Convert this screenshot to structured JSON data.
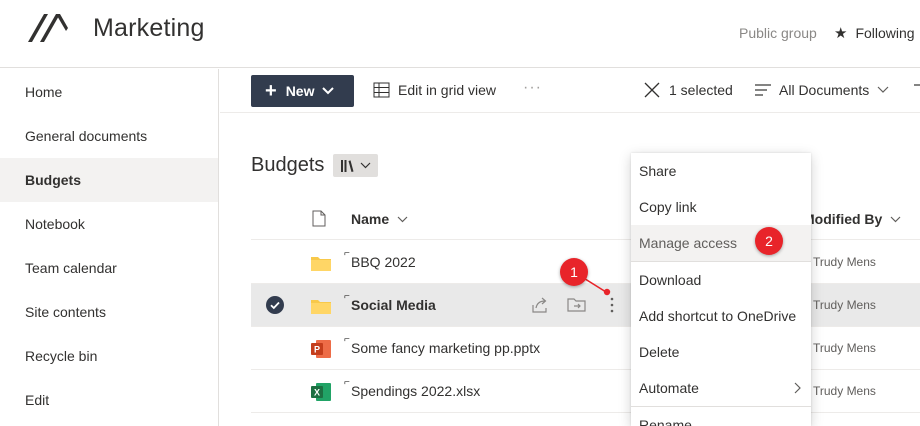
{
  "header": {
    "site_title": "Marketing",
    "public_group": "Public group",
    "following": "Following",
    "logo_icon": "marketing-logo",
    "star_icon": "star-icon"
  },
  "nav": {
    "items": [
      {
        "label": "Home"
      },
      {
        "label": "General documents"
      },
      {
        "label": "Budgets",
        "active": true
      },
      {
        "label": "Notebook"
      },
      {
        "label": "Team calendar"
      },
      {
        "label": "Site contents"
      },
      {
        "label": "Recycle bin"
      },
      {
        "label": "Edit"
      }
    ]
  },
  "commandbar": {
    "new_label": "New",
    "edit_grid_label": "Edit in grid view",
    "more_label": "···",
    "selected_label": "1 selected",
    "view_label": "All Documents"
  },
  "library": {
    "title": "Budgets"
  },
  "columns": {
    "name": "Name",
    "modified_by": "Modified By"
  },
  "rows": [
    {
      "name": "BBQ 2022",
      "modified_by": "Trudy Mens",
      "type": "folder"
    },
    {
      "name": "Social Media",
      "modified_by": "Trudy Mens",
      "type": "folder",
      "selected": true
    },
    {
      "name": "Some fancy marketing pp.pptx",
      "modified_by": "Trudy Mens",
      "type": "pptx"
    },
    {
      "name": "Spendings 2022.xlsx",
      "modified_by": "Trudy Mens",
      "type": "xlsx"
    }
  ],
  "context_menu": {
    "items": [
      {
        "label": "Share"
      },
      {
        "label": "Copy link"
      },
      {
        "label": "Manage access",
        "highlighted": true
      },
      {
        "label": "Download"
      },
      {
        "label": "Add shortcut to OneDrive"
      },
      {
        "label": "Delete"
      },
      {
        "label": "Automate",
        "submenu": true
      },
      {
        "label": "Rename"
      }
    ]
  },
  "annotations": {
    "step1": "1",
    "step2": "2",
    "color": "#e8242a"
  },
  "colors": {
    "primary_button": "#323c4e",
    "selected_row": "#e9e9e9",
    "nav_active": "#f3f2f1",
    "folder": "#f8c94a",
    "pptx": "#c43e1c",
    "xlsx": "#1d6f42"
  }
}
